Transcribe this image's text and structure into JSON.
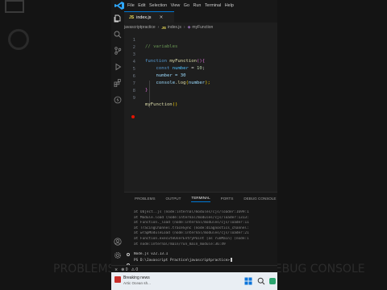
{
  "menu": [
    "File",
    "Edit",
    "Selection",
    "View",
    "Go",
    "Run",
    "Terminal",
    "Help"
  ],
  "tab": {
    "icon_text": "JS",
    "label": "index.js",
    "close": "×"
  },
  "breadcrumb": {
    "folder": "javascriptpractice",
    "file": "index.js",
    "symbol": "myFunction"
  },
  "editor": {
    "line_numbers": [
      "1",
      "2",
      "3",
      "4",
      "5",
      "6",
      "7",
      "8",
      "9"
    ],
    "code": {
      "comment": "// variables",
      "func_kw": "function",
      "func_name": "myFunction",
      "func_parens": "()",
      "open_brace": "{",
      "const_kw": "const",
      "var_name": "number",
      "eq": " = ",
      "num10": "10",
      "semi": ";",
      "assign": "number = 30",
      "console": "console",
      "log": ".log",
      "open_p": "(",
      "log_arg": "number",
      "close_p": ");",
      "close_brace": "}",
      "call_name": "myFunction",
      "call_parens": "()"
    }
  },
  "panel": {
    "tabs": [
      "PROBLEMS",
      "OUTPUT",
      "TERMINAL",
      "PORTS",
      "DEBUG CONSOLE"
    ],
    "active_tab": "TERMINAL",
    "terminal_lines": [
      "at Object..js (node:internal/modules/cjs/loader:1699:1",
      "at Module.load (node:internal/modules/cjs/loader:1313:",
      "at Function._load (node:internal/modules/cjs/loader:11",
      "at TracingChannel.traceSync (node:diagnostics_channel:",
      "at wrapModuleLoad (node:internal/modules/cjs/loader:21",
      "at Function.executeUserEntryPoint [as runMain] (node:i",
      "at node:internal/main/run_main_module:36:49"
    ],
    "node_version": "Node.js v22.13.1",
    "prompt": "PS D:\\Javascript Practice\\javascriptpractice>"
  },
  "status": {
    "errors": "⊗ 0",
    "warnings": "⚠ 0"
  },
  "taskbar": {
    "news_title": "Breaking news",
    "news_sub": "Artic Ocean sh..."
  },
  "colors": {
    "accent": "#0078d4",
    "breakpoint": "#e51400",
    "editor_bg": "#1e1e1e"
  }
}
